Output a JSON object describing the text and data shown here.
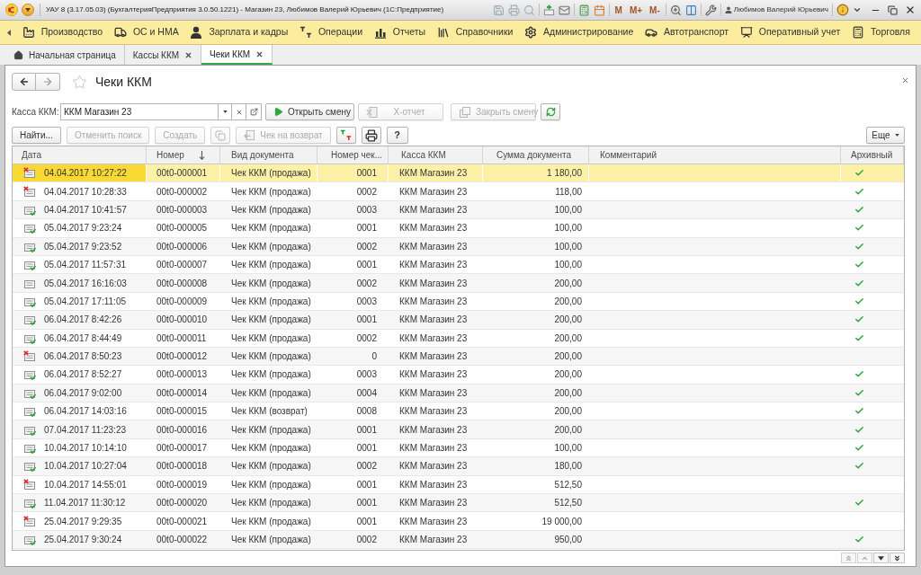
{
  "window": {
    "title": "УАУ 8 (3.17.05.03) (БухгалтерияПредприятия 3.0.50.1221) - Магазин 23, Любимов Валерий Юрьевич (1С:Предприятие)",
    "memory_buttons": [
      "M",
      "M+",
      "M-"
    ],
    "user": "Любимов Валерий Юрьевич"
  },
  "sections": [
    {
      "label": "Производство"
    },
    {
      "label": "ОС и НМА"
    },
    {
      "label": "Зарплата и кадры"
    },
    {
      "label": "Операции"
    },
    {
      "label": "Отчеты"
    },
    {
      "label": "Справочники"
    },
    {
      "label": "Администрирование"
    },
    {
      "label": "Автотранспорт"
    },
    {
      "label": "Оперативный учет"
    },
    {
      "label": "Торговля"
    }
  ],
  "tabs": [
    {
      "kind": "home",
      "label": "Начальная страница",
      "selected": false
    },
    {
      "kind": "page",
      "label": "Кассы ККМ",
      "selected": false
    },
    {
      "kind": "page",
      "label": "Чеки ККМ",
      "selected": true
    }
  ],
  "form": {
    "title": "Чеки ККМ",
    "favorite": false,
    "kassa": {
      "label": "Касса ККМ:",
      "value": "ККМ Магазин 23"
    },
    "shift_buttons": [
      {
        "label": "Открыть смену",
        "disabled": false
      },
      {
        "label": "X-отчет",
        "disabled": true
      },
      {
        "label": "Закрыть смену",
        "disabled": true
      }
    ],
    "command_bar": [
      {
        "kind": "text",
        "label": "Найти...",
        "disabled": false
      },
      {
        "kind": "text",
        "label": "Отменить поиск",
        "disabled": true
      },
      {
        "kind": "text",
        "label": "Создать",
        "disabled": true
      },
      {
        "kind": "icon",
        "disabled": true
      },
      {
        "kind": "icon_text",
        "label": "Чек на возврат",
        "disabled": true
      },
      {
        "kind": "icon",
        "disabled": false
      },
      {
        "kind": "icon",
        "disabled": false
      },
      {
        "kind": "text",
        "label": "?",
        "disabled": false
      }
    ],
    "more_button": "Еще"
  },
  "table": {
    "columns": [
      {
        "label": "Дата",
        "sorted": false
      },
      {
        "label": "Номер",
        "sorted": true
      },
      {
        "label": "Вид документа",
        "sorted": false
      },
      {
        "label": "Номер чек...",
        "sorted": false
      },
      {
        "label": "Касса ККМ",
        "sorted": false
      },
      {
        "label": "Сумма документа",
        "sorted": false
      },
      {
        "label": "Комментарий",
        "sorted": false
      },
      {
        "label": "Архивный",
        "sorted": false
      }
    ],
    "rows": [
      {
        "kind": "deleted",
        "selected": true,
        "date": "04.04.2017 10:27:22",
        "number": "00t0-000001",
        "doc_type": "Чек ККМ (продажа)",
        "check_number": "0001",
        "kassa": "ККМ Магазин 23",
        "sum": "1 180,00",
        "archived": true
      },
      {
        "kind": "deleted",
        "selected": false,
        "date": "04.04.2017 10:28:33",
        "number": "00t0-000002",
        "doc_type": "Чек ККМ (продажа)",
        "check_number": "0002",
        "kassa": "ККМ Магазин 23",
        "sum": "118,00",
        "archived": true
      },
      {
        "kind": "posted",
        "selected": false,
        "date": "04.04.2017 10:41:57",
        "number": "00t0-000003",
        "doc_type": "Чек ККМ (продажа)",
        "check_number": "0003",
        "kassa": "ККМ Магазин 23",
        "sum": "100,00",
        "archived": true
      },
      {
        "kind": "posted",
        "selected": false,
        "date": "05.04.2017 9:23:24",
        "number": "00t0-000005",
        "doc_type": "Чек ККМ (продажа)",
        "check_number": "0001",
        "kassa": "ККМ Магазин 23",
        "sum": "100,00",
        "archived": true
      },
      {
        "kind": "posted",
        "selected": false,
        "date": "05.04.2017 9:23:52",
        "number": "00t0-000006",
        "doc_type": "Чек ККМ (продажа)",
        "check_number": "0002",
        "kassa": "ККМ Магазин 23",
        "sum": "100,00",
        "archived": true
      },
      {
        "kind": "posted",
        "selected": false,
        "date": "05.04.2017 11:57:31",
        "number": "00t0-000007",
        "doc_type": "Чек ККМ (продажа)",
        "check_number": "0001",
        "kassa": "ККМ Магазин 23",
        "sum": "100,00",
        "archived": true
      },
      {
        "kind": "draft",
        "selected": false,
        "date": "05.04.2017 16:16:03",
        "number": "00t0-000008",
        "doc_type": "Чек ККМ (продажа)",
        "check_number": "0002",
        "kassa": "ККМ Магазин 23",
        "sum": "200,00",
        "archived": true
      },
      {
        "kind": "posted",
        "selected": false,
        "date": "05.04.2017 17:11:05",
        "number": "00t0-000009",
        "doc_type": "Чек ККМ (продажа)",
        "check_number": "0003",
        "kassa": "ККМ Магазин 23",
        "sum": "200,00",
        "archived": true
      },
      {
        "kind": "posted",
        "selected": false,
        "date": "06.04.2017 8:42:26",
        "number": "00t0-000010",
        "doc_type": "Чек ККМ (продажа)",
        "check_number": "0001",
        "kassa": "ККМ Магазин 23",
        "sum": "200,00",
        "archived": true
      },
      {
        "kind": "posted",
        "selected": false,
        "date": "06.04.2017 8:44:49",
        "number": "00t0-000011",
        "doc_type": "Чек ККМ (продажа)",
        "check_number": "0002",
        "kassa": "ККМ Магазин 23",
        "sum": "200,00",
        "archived": true
      },
      {
        "kind": "deleted",
        "selected": false,
        "date": "06.04.2017 8:50:23",
        "number": "00t0-000012",
        "doc_type": "Чек ККМ (продажа)",
        "check_number": "0",
        "kassa": "ККМ Магазин 23",
        "sum": "200,00",
        "archived": false
      },
      {
        "kind": "posted",
        "selected": false,
        "date": "06.04.2017 8:52:27",
        "number": "00t0-000013",
        "doc_type": "Чек ККМ (продажа)",
        "check_number": "0003",
        "kassa": "ККМ Магазин 23",
        "sum": "200,00",
        "archived": true
      },
      {
        "kind": "posted",
        "selected": false,
        "date": "06.04.2017 9:02:00",
        "number": "00t0-000014",
        "doc_type": "Чек ККМ (продажа)",
        "check_number": "0004",
        "kassa": "ККМ Магазин 23",
        "sum": "200,00",
        "archived": true
      },
      {
        "kind": "posted",
        "selected": false,
        "date": "06.04.2017 14:03:16",
        "number": "00t0-000015",
        "doc_type": "Чек ККМ (возврат)",
        "check_number": "0008",
        "kassa": "ККМ Магазин 23",
        "sum": "200,00",
        "archived": true
      },
      {
        "kind": "posted",
        "selected": false,
        "date": "07.04.2017 11:23:23",
        "number": "00t0-000016",
        "doc_type": "Чек ККМ (продажа)",
        "check_number": "0001",
        "kassa": "ККМ Магазин 23",
        "sum": "200,00",
        "archived": true
      },
      {
        "kind": "posted",
        "selected": false,
        "date": "10.04.2017 10:14:10",
        "number": "00t0-000017",
        "doc_type": "Чек ККМ (продажа)",
        "check_number": "0001",
        "kassa": "ККМ Магазин 23",
        "sum": "100,00",
        "archived": true
      },
      {
        "kind": "posted",
        "selected": false,
        "date": "10.04.2017 10:27:04",
        "number": "00t0-000018",
        "doc_type": "Чек ККМ (продажа)",
        "check_number": "0002",
        "kassa": "ККМ Магазин 23",
        "sum": "180,00",
        "archived": true
      },
      {
        "kind": "deleted",
        "selected": false,
        "date": "10.04.2017 14:55:01",
        "number": "00t0-000019",
        "doc_type": "Чек ККМ (продажа)",
        "check_number": "0001",
        "kassa": "ККМ Магазин 23",
        "sum": "512,50",
        "archived": false
      },
      {
        "kind": "posted",
        "selected": false,
        "date": "11.04.2017 11:30:12",
        "number": "00t0-000020",
        "doc_type": "Чек ККМ (продажа)",
        "check_number": "0001",
        "kassa": "ККМ Магазин 23",
        "sum": "512,50",
        "archived": true
      },
      {
        "kind": "deleted",
        "selected": false,
        "date": "25.04.2017 9:29:35",
        "number": "00t0-000021",
        "doc_type": "Чек ККМ (продажа)",
        "check_number": "0001",
        "kassa": "ККМ Магазин 23",
        "sum": "19 000,00",
        "archived": false
      },
      {
        "kind": "posted",
        "selected": false,
        "date": "25.04.2017 9:30:24",
        "number": "00t0-000022",
        "doc_type": "Чек ККМ (продажа)",
        "check_number": "0002",
        "kassa": "ККМ Магазин 23",
        "sum": "950,00",
        "archived": true
      }
    ]
  }
}
